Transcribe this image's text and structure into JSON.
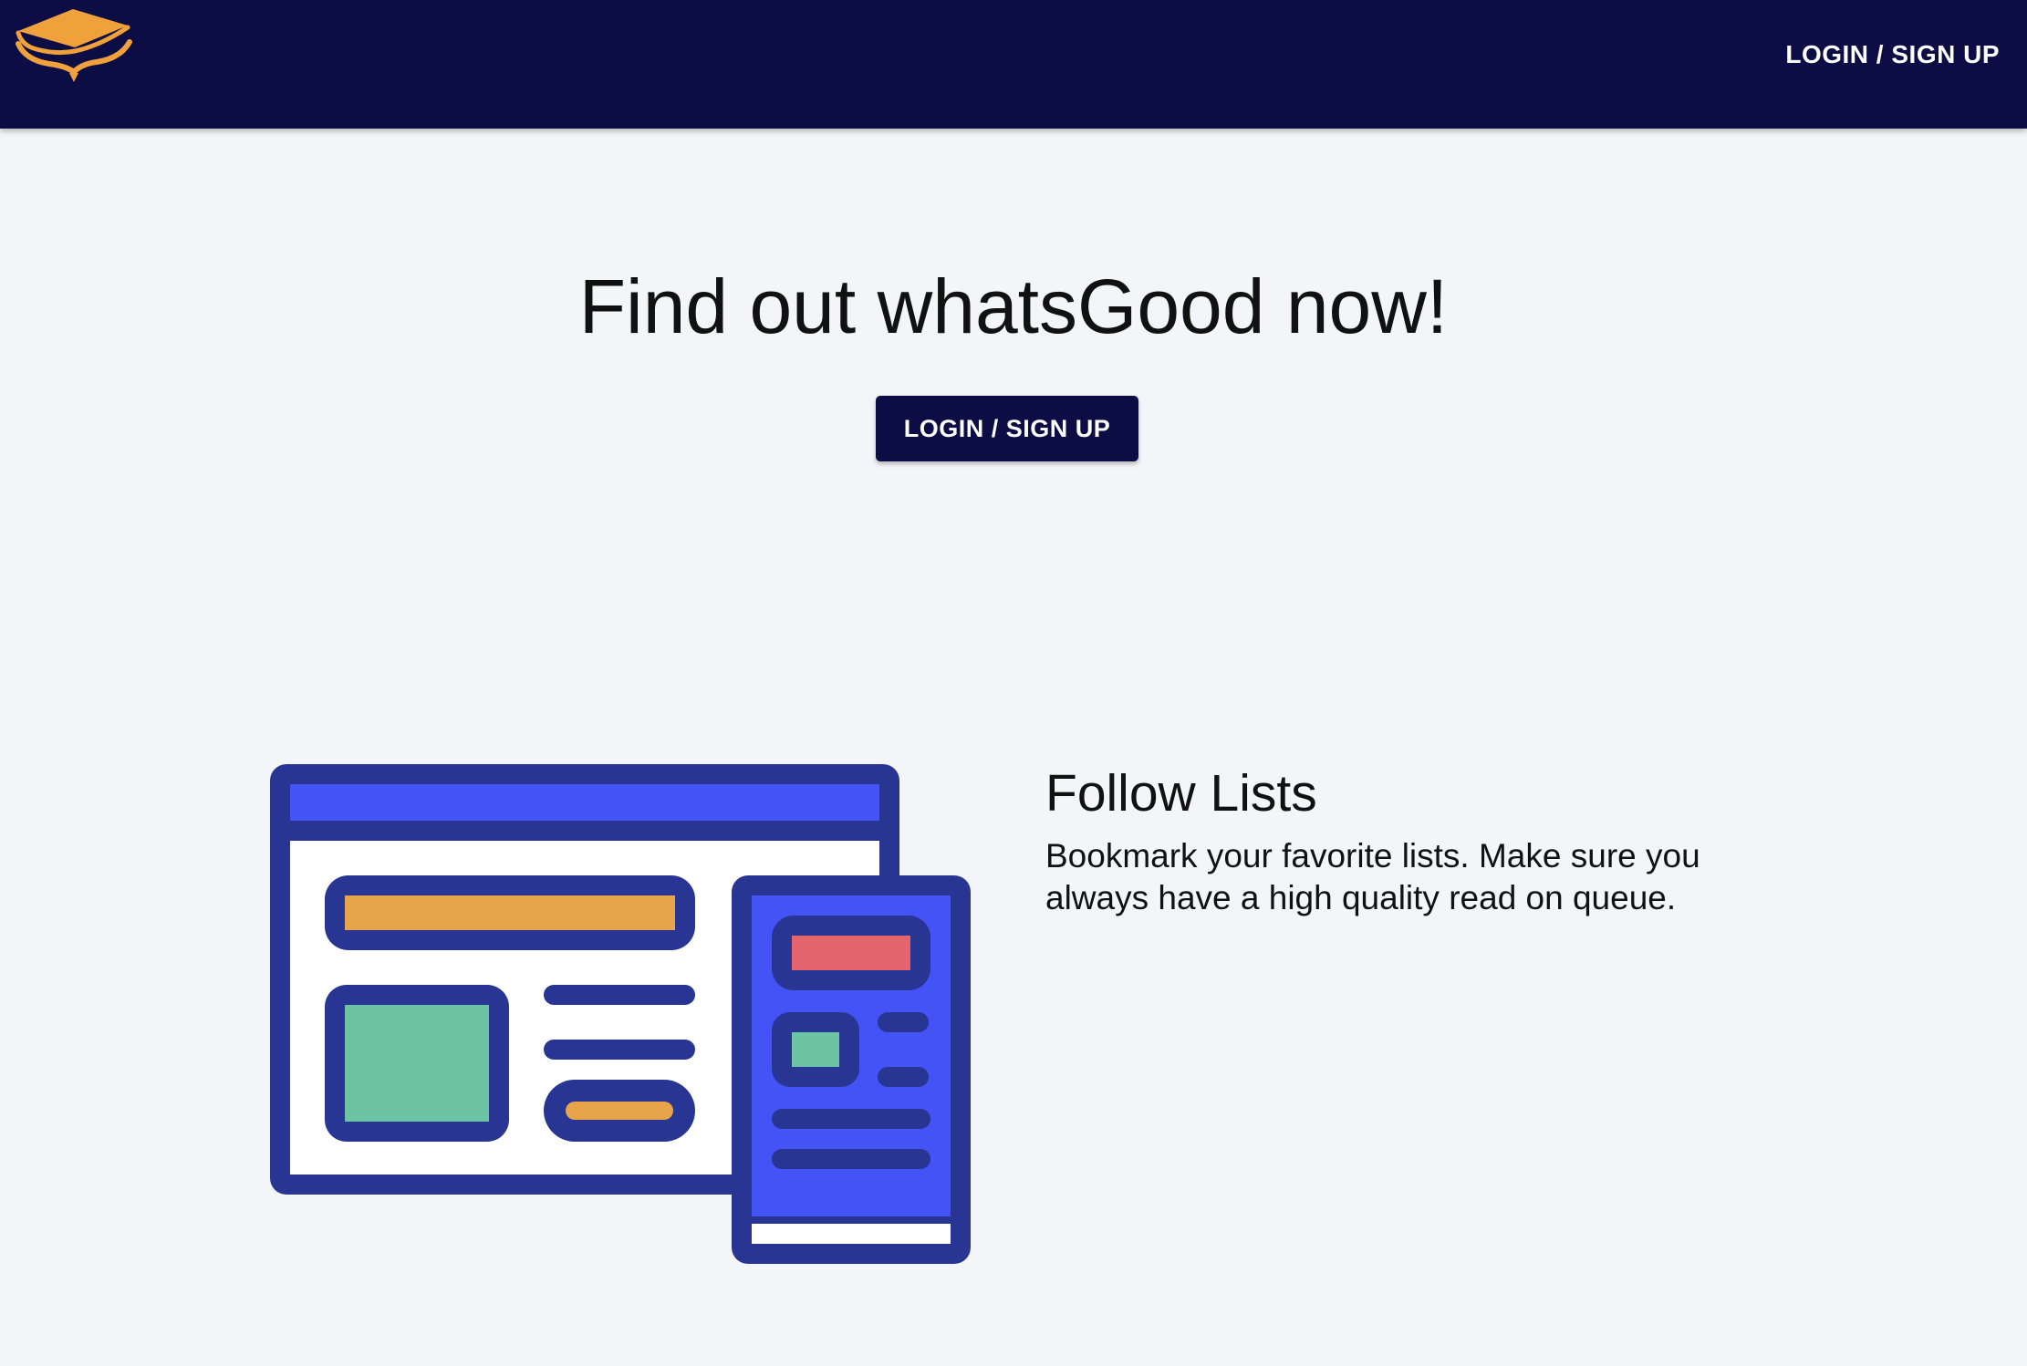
{
  "header": {
    "logo_icon": "book-stack-logo-icon",
    "login_label": "LOGIN / SIGN UP",
    "background_color": "#0d0d45",
    "logo_color": "#f0a13c"
  },
  "hero": {
    "title": "Find out whatsGood now!",
    "button_label": "LOGIN / SIGN UP"
  },
  "feature": {
    "illustration_icon": "browser-and-phone-lists-illustration",
    "title": "Follow Lists",
    "description": "Bookmark your favorite lists. Make sure you always have a high quality read on queue."
  },
  "colors": {
    "page_background": "#f4f5f8",
    "primary": "#0d0d45",
    "illustration_outline": "#283593",
    "illustration_blue": "#4353f5",
    "illustration_orange": "#e8a44a",
    "illustration_green": "#6dc4a4",
    "illustration_red": "#e4666c"
  }
}
